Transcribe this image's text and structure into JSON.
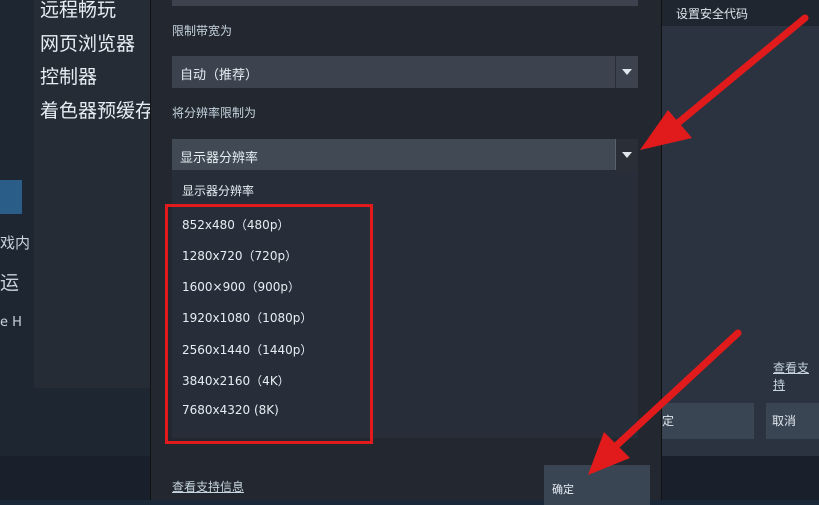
{
  "sidebar": {
    "items": [
      "远程畅玩",
      "网页浏览器",
      "控制器",
      "着色器预缓存"
    ]
  },
  "background": {
    "left_fragments": [
      "戏内",
      "运",
      "e H"
    ],
    "right_top_text": "设置安全代码",
    "right_link": "查看支持",
    "right_ok_fragment": "定",
    "right_cancel": "取消"
  },
  "dialog": {
    "bandwidth_label": "限制带宽为",
    "bandwidth_value": "自动（推荐）",
    "resolution_label": "将分辨率限制为",
    "resolution_value": "显示器分辨率",
    "options": [
      "显示器分辨率",
      "852x480（480p）",
      "1280x720（720p）",
      "1600×900（900p）",
      "1920x1080（1080p）",
      "2560x1440（1440p）",
      "3840x2160（4K）",
      "7680x4320 (8K)"
    ],
    "support_link": "查看支持信息",
    "confirm": "确定"
  },
  "colors": {
    "annotation_red": "#e11b1b",
    "dialog_bg": "#23272f",
    "select_bg": "#3c434e"
  }
}
